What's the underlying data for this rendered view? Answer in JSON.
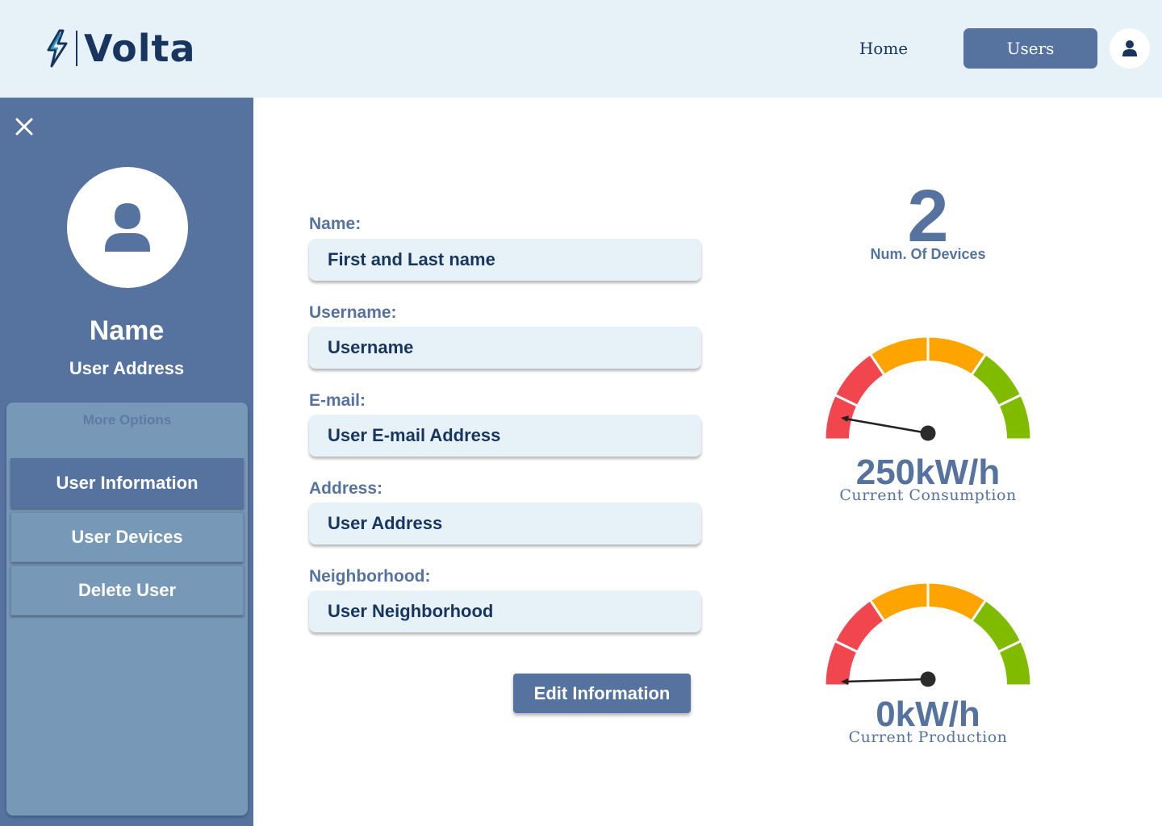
{
  "app": {
    "brand": "Volta"
  },
  "nav": {
    "home": "Home",
    "users": "Users"
  },
  "colors": {
    "primary": "#5673a0",
    "dark": "#17355f",
    "light": "#e7f2f8",
    "panel": "#7898b8",
    "gauge_red": "#f2464e",
    "gauge_orange": "#fda400",
    "gauge_green": "#80bb00"
  },
  "sidebar": {
    "name": "Name",
    "address": "User Address",
    "options_title": "More Options",
    "options": [
      {
        "label": "User Information",
        "active": true
      },
      {
        "label": "User Devices",
        "active": false
      },
      {
        "label": "Delete User",
        "active": false
      }
    ]
  },
  "form": {
    "fields": [
      {
        "label": "Name:",
        "value": "First and Last name"
      },
      {
        "label": "Username:",
        "value": "Username"
      },
      {
        "label": "E-mail:",
        "value": "User E-mail Address"
      },
      {
        "label": "Address:",
        "value": "User Address"
      },
      {
        "label": "Neighborhood:",
        "value": "User Neighborhood"
      }
    ],
    "edit_button": "Edit Information"
  },
  "stats": {
    "devices_count": "2",
    "devices_label": "Num. Of Devices",
    "consumption_value": "250kW/h",
    "consumption_label": "Current Consumption",
    "production_value": "0kW/h",
    "production_label": "Current Production"
  },
  "icons": {
    "logo": "lightning-bolt-icon",
    "close": "close-icon",
    "user": "user-icon"
  }
}
